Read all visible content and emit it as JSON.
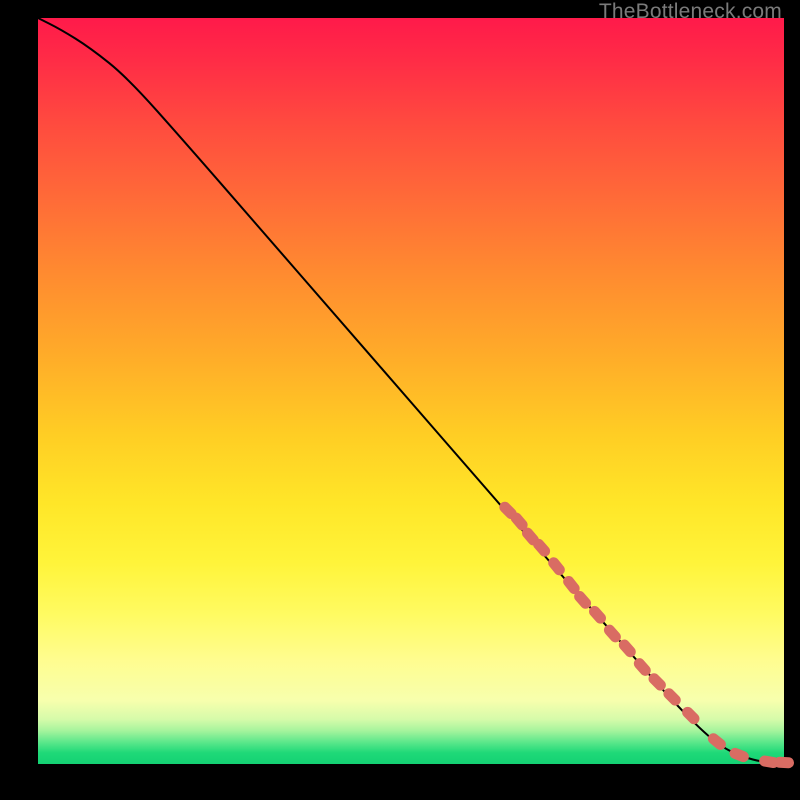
{
  "watermark": "TheBottleneck.com",
  "colors": {
    "point": "#d96c63",
    "curve": "#000000",
    "frame_bg": "#000000"
  },
  "chart_data": {
    "type": "line",
    "title": "",
    "xlabel": "",
    "ylabel": "",
    "xlim": [
      0,
      100
    ],
    "ylim": [
      0,
      100
    ],
    "grid": false,
    "legend": false,
    "series": [
      {
        "name": "curve",
        "kind": "line",
        "x": [
          0,
          3,
          7,
          12,
          20,
          30,
          40,
          50,
          60,
          70,
          78,
          85,
          90,
          93,
          96,
          98,
          100
        ],
        "y": [
          100,
          98.5,
          96,
          92,
          83,
          71.5,
          60,
          48.5,
          37,
          25.5,
          16.5,
          8.5,
          3.5,
          1.5,
          0.5,
          0.2,
          0.2
        ]
      },
      {
        "name": "points",
        "kind": "scatter",
        "note": "elongated markers along the curve below ~y=42; values read off the plotted curve",
        "x": [
          63,
          64.5,
          66,
          67.5,
          69.5,
          71.5,
          73,
          75,
          77,
          79,
          81,
          83,
          85,
          87.5,
          91,
          94,
          98,
          100
        ],
        "y": [
          34,
          32.5,
          30.5,
          29,
          26.5,
          24,
          22,
          20,
          17.5,
          15.5,
          13,
          11,
          9,
          6.5,
          3,
          1.2,
          0.3,
          0.2
        ]
      }
    ]
  }
}
